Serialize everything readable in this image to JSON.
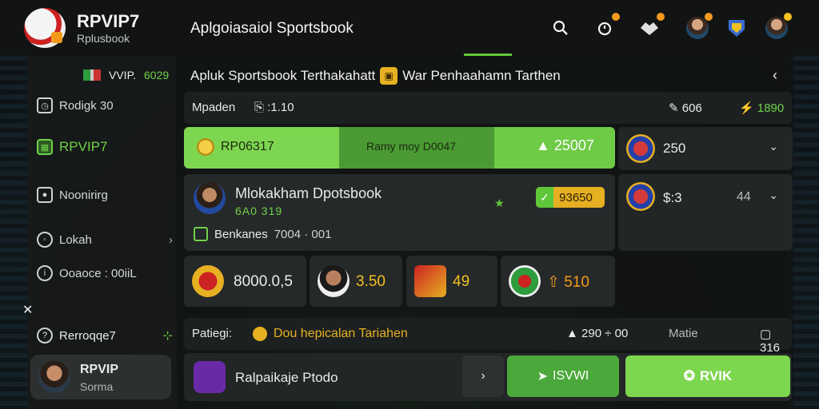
{
  "header": {
    "brand": "RPVIP7",
    "brand_sub": "Rplusbook",
    "title": "Aplgoiasaiol Sportsbook"
  },
  "sidebar": {
    "top_value": "VVIP.",
    "top_num": "6029",
    "items": [
      {
        "label": "Rodigk 30"
      },
      {
        "label": "RPVIP7"
      },
      {
        "label": "Noonirirg"
      },
      {
        "label": "Lokah"
      },
      {
        "label": "Ooaoce : 00iiL"
      }
    ],
    "footer_item": "Rerroqqe7",
    "user": {
      "name": "RPVIP",
      "sub": "Sorma"
    }
  },
  "main": {
    "title": "Apluk Sportsbook Terthakahatt",
    "title_suffix": "War Penhaahamn Tarthen",
    "filter": {
      "label": "Mpaden",
      "mid": ":1.10",
      "r1": "606",
      "r2": "1890"
    },
    "hero": {
      "c1": "RP06317",
      "c2": "Ramy moy D0047",
      "c3": "25007"
    },
    "right_cards": [
      {
        "val": "250",
        "val2": ""
      },
      {
        "val": "$:3",
        "val2": "44"
      }
    ],
    "match": {
      "name": "Mlokakham Dpotsbook",
      "score": "6A0 319",
      "odds": "93650",
      "bonus_label": "Benkanes",
      "bonus_value": "7004 · 001"
    },
    "tiles": [
      {
        "val": "8000.0,5"
      },
      {
        "val": "3.50"
      },
      {
        "val": "49"
      },
      {
        "val": "510"
      }
    ],
    "notice": {
      "label": "Patiegi:",
      "msg": "Dou hepicalan Tariahen",
      "v1": "290 ÷ 00",
      "v2": "Matie",
      "v3": "316"
    },
    "footer": {
      "title": "Ralpaikaje Ptodo",
      "btn1": "ISVWI",
      "btn2": "RVIK"
    }
  }
}
